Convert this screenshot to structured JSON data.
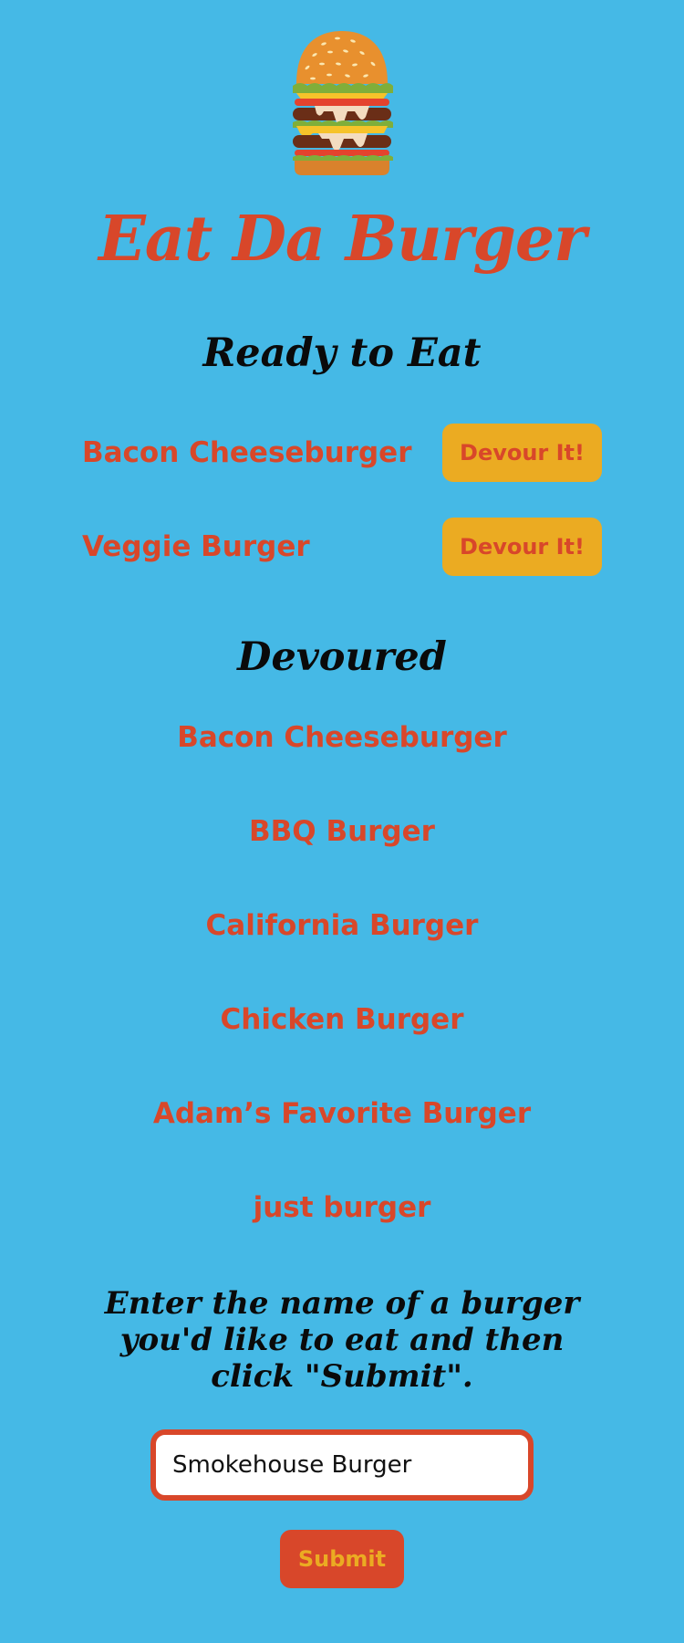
{
  "app": {
    "title": "Eat Da Burger",
    "logo_icon": "burger-icon"
  },
  "colors": {
    "background": "#45b9e6",
    "accent_red": "#d8472a",
    "button_yellow": "#ebab22",
    "heading_black": "#0a0a0a"
  },
  "ready": {
    "heading": "Ready to Eat",
    "items": [
      {
        "name": "Bacon Cheeseburger",
        "button_label": "Devour It!"
      },
      {
        "name": "Veggie Burger",
        "button_label": "Devour It!"
      }
    ]
  },
  "devoured": {
    "heading": "Devoured",
    "items": [
      "Bacon Cheeseburger",
      "BBQ Burger",
      "California Burger",
      "Chicken Burger",
      "Adam’s Favorite Burger",
      "just burger"
    ]
  },
  "form": {
    "instructions": "Enter the name of a burger you'd like to eat and then click \"Submit\".",
    "input_value": "Smokehouse Burger",
    "submit_label": "Submit"
  }
}
